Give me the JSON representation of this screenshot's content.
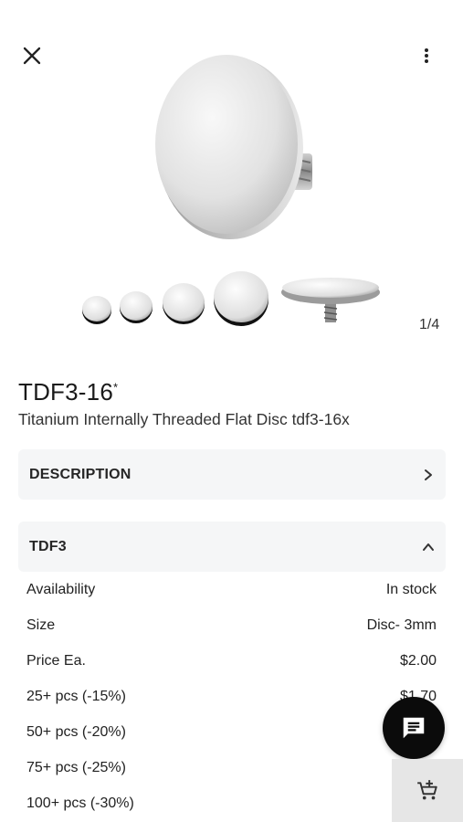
{
  "gallery": {
    "counter": "1/4"
  },
  "product": {
    "code": "TDF3-16",
    "mark": "*",
    "subtitle": "Titanium Internally Threaded Flat Disc tdf3-16x"
  },
  "sections": {
    "description_label": "DESCRIPTION",
    "variant_label": "TDF3"
  },
  "specs": [
    {
      "label": "Availability",
      "value": "In stock"
    },
    {
      "label": "Size",
      "value": "Disc- 3mm"
    },
    {
      "label": "Price Ea.",
      "value": "$2.00"
    },
    {
      "label": "25+ pcs (-15%)",
      "value": "$1.70"
    },
    {
      "label": "50+ pcs (-20%)",
      "value": ""
    },
    {
      "label": "75+ pcs (-25%)",
      "value": ""
    },
    {
      "label": "100+ pcs (-30%)",
      "value": ""
    }
  ],
  "icons": {
    "close": "close-icon",
    "more": "more-vert-icon",
    "chat": "chat-icon",
    "cart": "add-to-cart-icon",
    "expand": "chevron-right-icon",
    "collapse": "chevron-up-icon"
  }
}
